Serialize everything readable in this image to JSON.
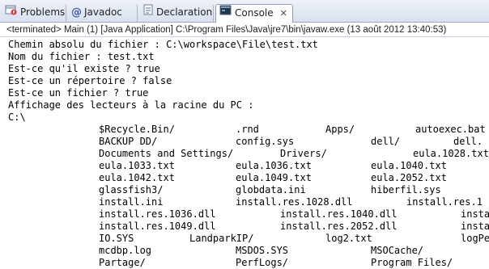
{
  "tabs": [
    {
      "label": "Problems",
      "icon": "problems-icon"
    },
    {
      "label": "Javadoc",
      "icon": "javadoc-at-icon"
    },
    {
      "label": "Declaration",
      "icon": "declaration-icon"
    },
    {
      "label": "Console",
      "icon": "console-icon",
      "active": true
    }
  ],
  "close_glyph": "✕",
  "status": "<terminated> Main (1) [Java Application] C:\\Program Files\\Java\\jre7\\bin\\javaw.exe (13 août 2012 13:40:53)",
  "console": {
    "lines": [
      "Chemin absolu du fichier : C:\\workspace\\File\\test.txt",
      "Nom du fichier : test.txt",
      "Est-ce qu'il existe ? true",
      "Est-ce un répertoire ? false",
      "Est-ce un fichier ? true",
      "Affichage des lecteurs à la racine du PC :",
      "C:\\"
    ],
    "listing": [
      [
        "$Recycle.Bin/",
        ".rnd",
        "Apps/",
        "autoexec.bat"
      ],
      [
        "BACKUP DD/",
        "config.sys",
        "dell/",
        "dell."
      ],
      [
        "Documents and Settings/",
        "Drivers/",
        "eula.1028.txt"
      ],
      [
        "eula.1033.txt",
        "eula.1036.txt",
        "eula.1040.txt"
      ],
      [
        "eula.1042.txt",
        "eula.1049.txt",
        "eula.2052.txt"
      ],
      [
        "glassfish3/",
        "globdata.ini",
        "hiberfil.sys"
      ],
      [
        "install.ini",
        "install.res.1028.dll",
        "install.res.1"
      ],
      [
        "install.res.1036.dll",
        "install.res.1040.dll",
        "insta"
      ],
      [
        "install.res.1049.dll",
        "install.res.2052.dll",
        "insta"
      ],
      [
        "IO.SYS",
        "LandparkIP/",
        "log2.txt",
        "logPe"
      ],
      [
        "mcdbp.log",
        "MSDOS.SYS",
        "MSOCache/"
      ],
      [
        "Partage/",
        "PerfLogs/",
        "Program Files/"
      ]
    ]
  },
  "colors": {
    "tab_bg": "#d9e1ee",
    "active_tab_bg": "#ffffff",
    "console_text": "#000000"
  }
}
